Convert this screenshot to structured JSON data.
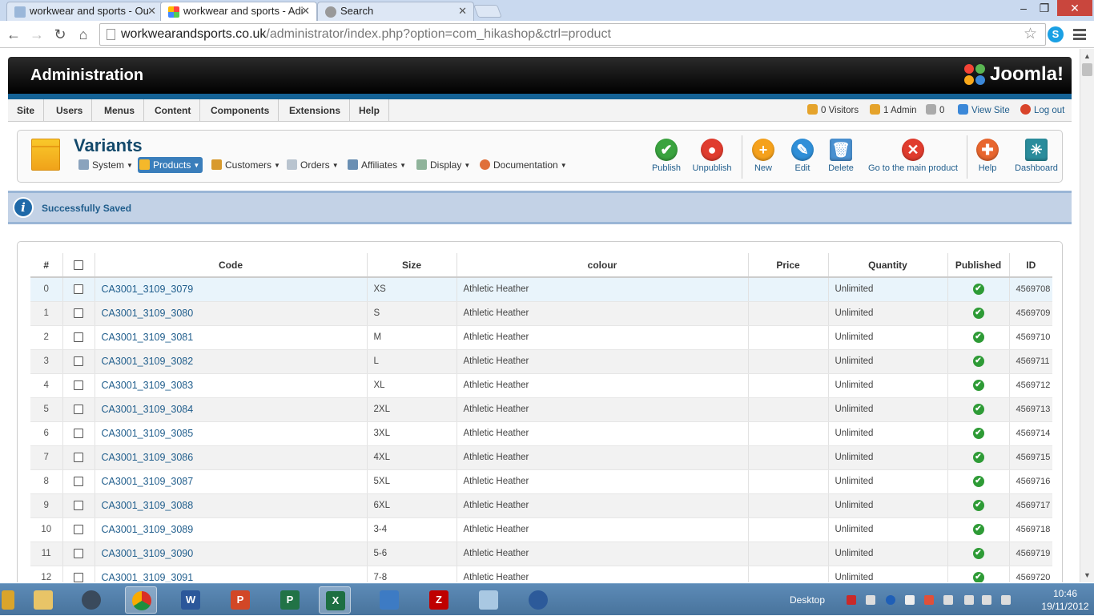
{
  "browser": {
    "tabs": [
      {
        "label": "workwear and sports - Ou",
        "active": false
      },
      {
        "label": "workwear and sports - Adi",
        "active": true
      },
      {
        "label": "Search",
        "active": false
      }
    ],
    "url_host": "workwearandsports.co.uk",
    "url_path": "/administrator/index.php?option=com_hikashop&ctrl=product"
  },
  "admin": {
    "title": "Administration",
    "logo_text": "Joomla!",
    "menu": [
      "Site",
      "Users",
      "Menus",
      "Content",
      "Components",
      "Extensions",
      "Help"
    ],
    "status": {
      "visitors": "0 Visitors",
      "admins": "1 Admin",
      "messages": "0",
      "view_site": "View Site",
      "logout": "Log out"
    }
  },
  "toolbar": {
    "page_title": "Variants",
    "submenu": [
      {
        "label": "System",
        "icon": "wrench-icon"
      },
      {
        "label": "Products",
        "icon": "box-icon",
        "active": true
      },
      {
        "label": "Customers",
        "icon": "customers-icon"
      },
      {
        "label": "Orders",
        "icon": "orders-icon"
      },
      {
        "label": "Affiliates",
        "icon": "affiliates-icon"
      },
      {
        "label": "Display",
        "icon": "display-icon"
      },
      {
        "label": "Documentation",
        "icon": "lifebuoy-icon"
      }
    ],
    "buttons": {
      "publish": "Publish",
      "unpublish": "Unpublish",
      "new": "New",
      "edit": "Edit",
      "delete": "Delete",
      "main_product": "Go to the main product",
      "help": "Help",
      "dashboard": "Dashboard"
    }
  },
  "message": "Successfully Saved",
  "table": {
    "headers": {
      "num": "#",
      "code": "Code",
      "size": "Size",
      "colour": "colour",
      "price": "Price",
      "quantity": "Quantity",
      "published": "Published",
      "id": "ID"
    },
    "rows": [
      {
        "num": "0",
        "code": "CA3001_3109_3079",
        "size": "XS",
        "colour": "Athletic Heather",
        "price": "",
        "quantity": "Unlimited",
        "id": "4569708"
      },
      {
        "num": "1",
        "code": "CA3001_3109_3080",
        "size": "S",
        "colour": "Athletic Heather",
        "price": "",
        "quantity": "Unlimited",
        "id": "4569709"
      },
      {
        "num": "2",
        "code": "CA3001_3109_3081",
        "size": "M",
        "colour": "Athletic Heather",
        "price": "",
        "quantity": "Unlimited",
        "id": "4569710"
      },
      {
        "num": "3",
        "code": "CA3001_3109_3082",
        "size": "L",
        "colour": "Athletic Heather",
        "price": "",
        "quantity": "Unlimited",
        "id": "4569711"
      },
      {
        "num": "4",
        "code": "CA3001_3109_3083",
        "size": "XL",
        "colour": "Athletic Heather",
        "price": "",
        "quantity": "Unlimited",
        "id": "4569712"
      },
      {
        "num": "5",
        "code": "CA3001_3109_3084",
        "size": "2XL",
        "colour": "Athletic Heather",
        "price": "",
        "quantity": "Unlimited",
        "id": "4569713"
      },
      {
        "num": "6",
        "code": "CA3001_3109_3085",
        "size": "3XL",
        "colour": "Athletic Heather",
        "price": "",
        "quantity": "Unlimited",
        "id": "4569714"
      },
      {
        "num": "7",
        "code": "CA3001_3109_3086",
        "size": "4XL",
        "colour": "Athletic Heather",
        "price": "",
        "quantity": "Unlimited",
        "id": "4569715"
      },
      {
        "num": "8",
        "code": "CA3001_3109_3087",
        "size": "5XL",
        "colour": "Athletic Heather",
        "price": "",
        "quantity": "Unlimited",
        "id": "4569716"
      },
      {
        "num": "9",
        "code": "CA3001_3109_3088",
        "size": "6XL",
        "colour": "Athletic Heather",
        "price": "",
        "quantity": "Unlimited",
        "id": "4569717"
      },
      {
        "num": "10",
        "code": "CA3001_3109_3089",
        "size": "3-4",
        "colour": "Athletic Heather",
        "price": "",
        "quantity": "Unlimited",
        "id": "4569718"
      },
      {
        "num": "11",
        "code": "CA3001_3109_3090",
        "size": "5-6",
        "colour": "Athletic Heather",
        "price": "",
        "quantity": "Unlimited",
        "id": "4569719"
      },
      {
        "num": "12",
        "code": "CA3001_3109_3091",
        "size": "7-8",
        "colour": "Athletic Heather",
        "price": "",
        "quantity": "Unlimited",
        "id": "4569720"
      }
    ]
  },
  "taskbar": {
    "desktop_label": "Desktop",
    "time": "10:46",
    "date": "19/11/2012"
  },
  "colors": {
    "accent": "#146295",
    "link": "#1f5d8c",
    "publish": "#2e9b36"
  }
}
